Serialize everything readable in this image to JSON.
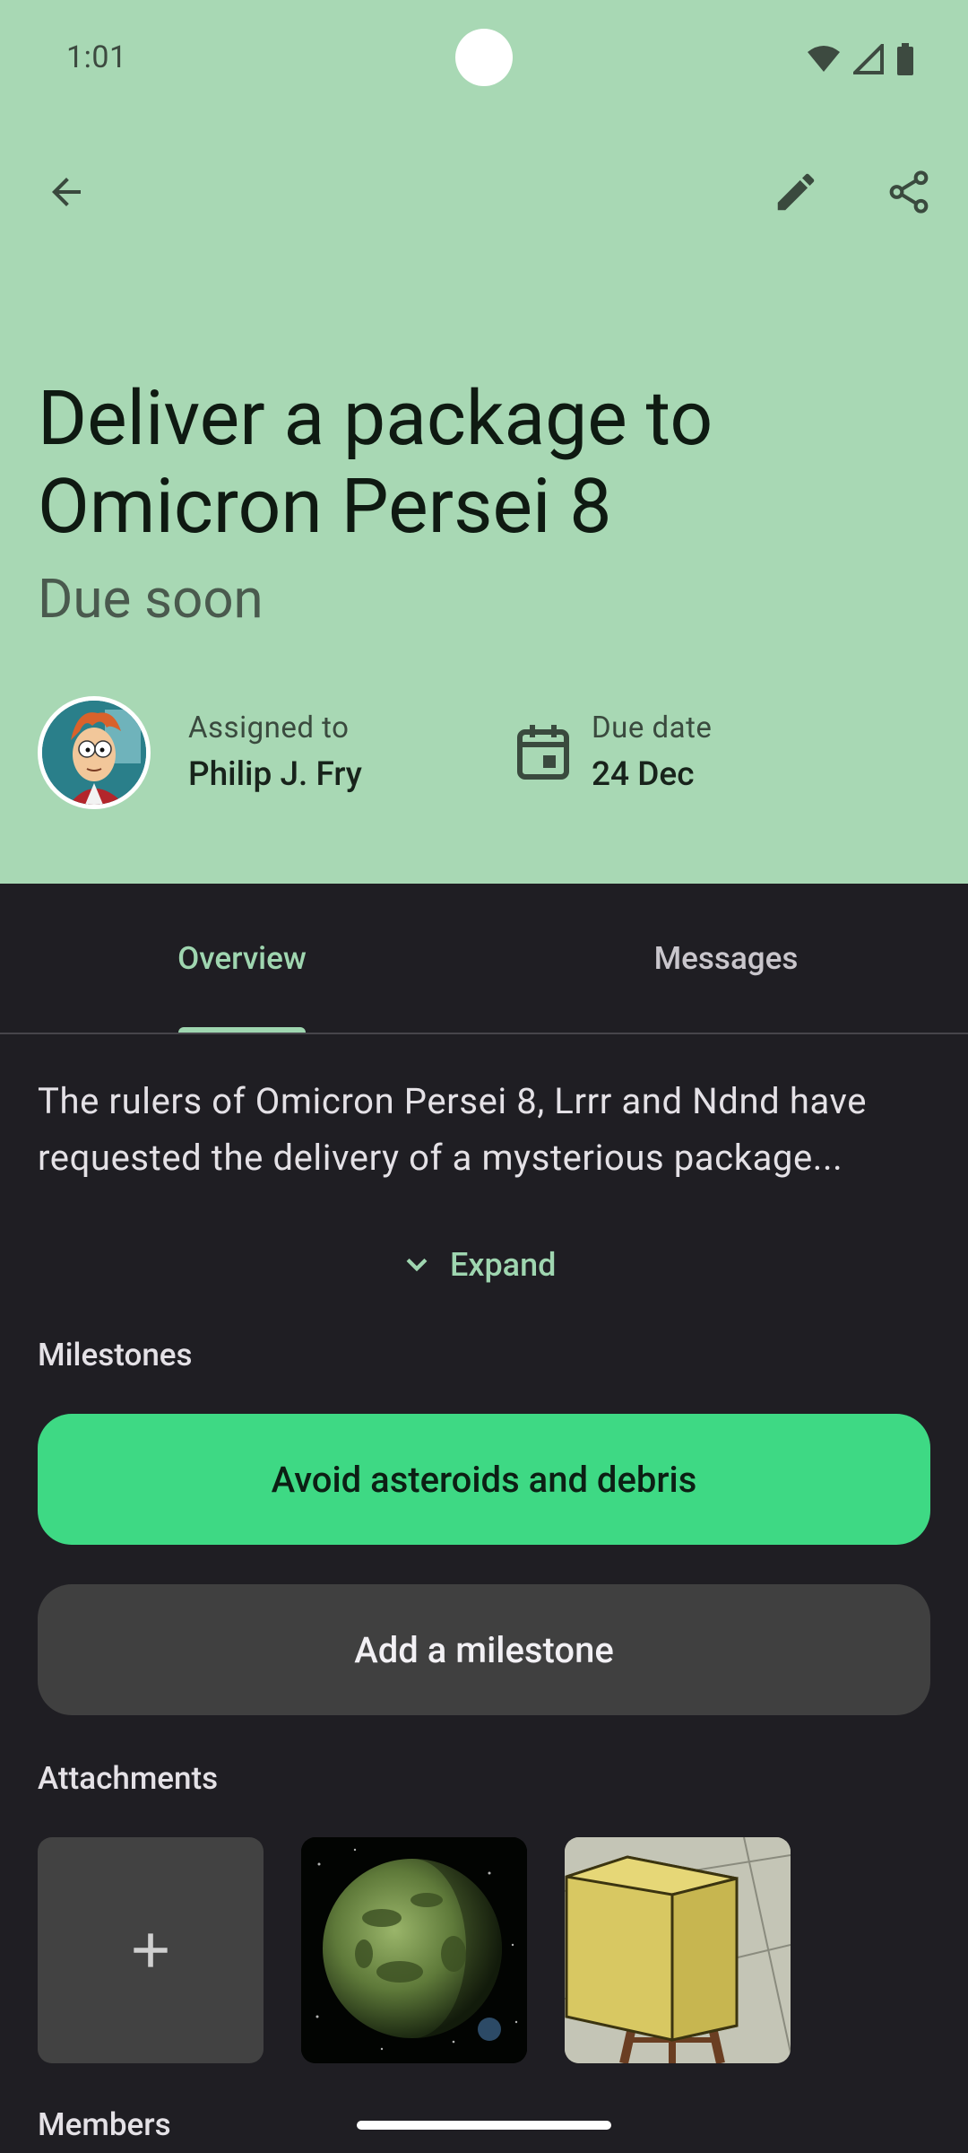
{
  "status_bar": {
    "time": "1:01"
  },
  "toolbar": {
    "back_icon": "arrow-back-icon",
    "edit_icon": "pencil-icon",
    "share_icon": "share-icon"
  },
  "task": {
    "title_line1": "Deliver a package to",
    "title_line2": "Omicron Persei 8",
    "status": "Due soon",
    "assigned_label": "Assigned to",
    "assigned_value": "Philip J. Fry",
    "due_label": "Due date",
    "due_value": "24 Dec"
  },
  "tabs": [
    {
      "label": "Overview",
      "selected": true
    },
    {
      "label": "Messages",
      "selected": false
    }
  ],
  "overview": {
    "description": "The rulers of Omicron Persei 8, Lrrr and Ndnd have requested the delivery of a mysterious package...",
    "expand_label": "Expand"
  },
  "milestones": {
    "title": "Milestones",
    "items": [
      {
        "label": "Avoid asteroids and debris"
      }
    ],
    "add_label": "Add a milestone"
  },
  "attachments": {
    "title": "Attachments",
    "add_icon": "plus-icon"
  },
  "members": {
    "title": "Members"
  },
  "colors": {
    "header_bg": "#a8d8b4",
    "surface": "#1f1e23",
    "accent": "#9fd6b0",
    "milestone_green": "#3ed984"
  }
}
